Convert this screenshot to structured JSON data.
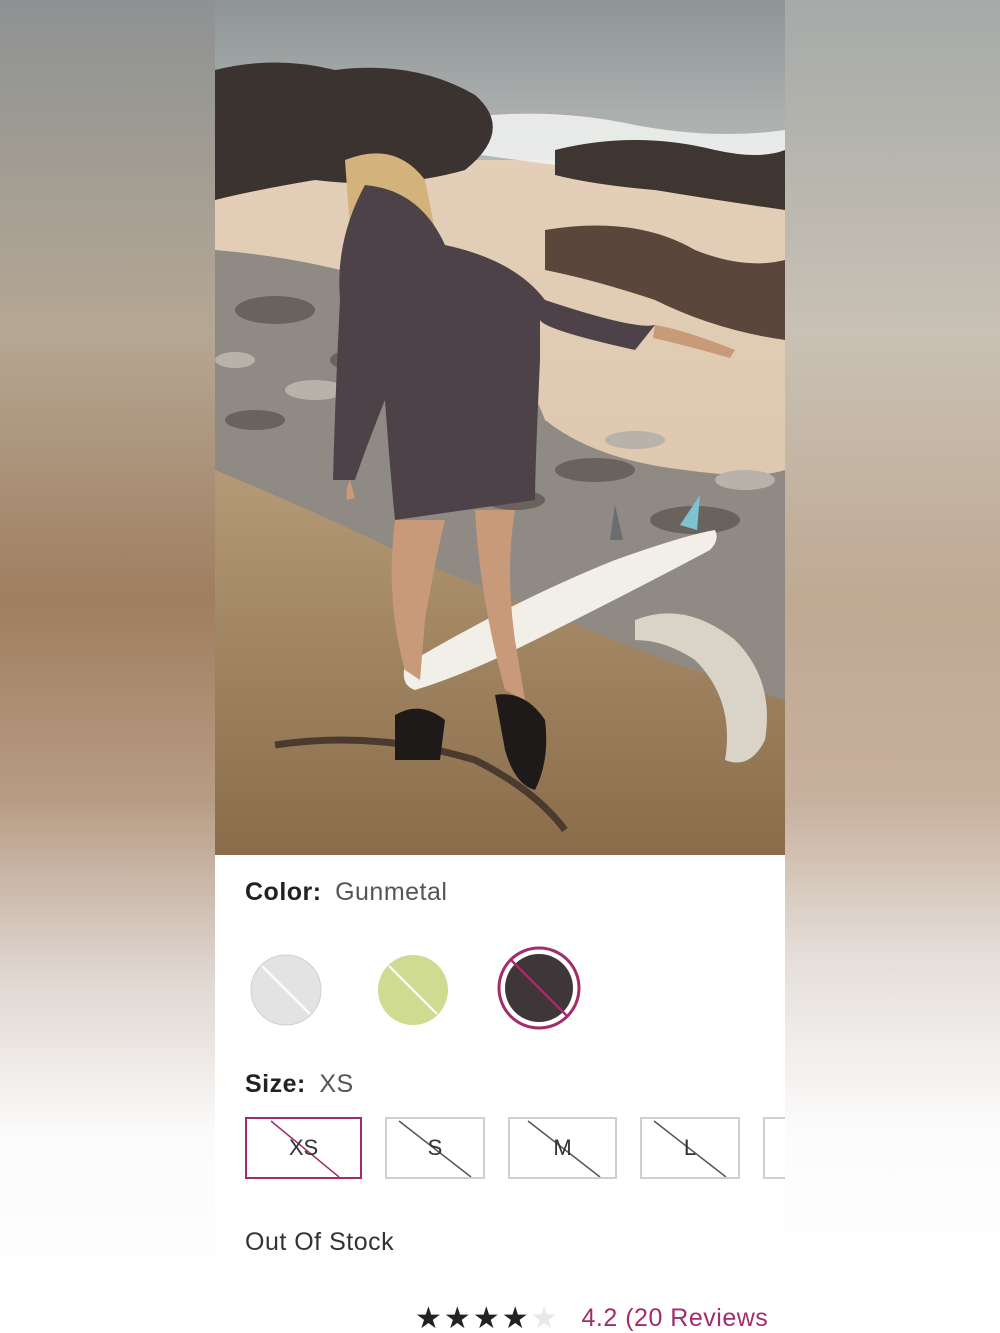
{
  "product": {
    "photo_alt": "Model walking on rocky beach toward surfboard wearing oversized dark t-shirt",
    "color": {
      "label": "Color:",
      "value": "Gunmetal"
    },
    "swatches": [
      {
        "name": "light grey",
        "hex": "#e3e3e3",
        "available": false,
        "selected": false
      },
      {
        "name": "lime",
        "hex": "#cfdb90",
        "available": false,
        "selected": false
      },
      {
        "name": "Gunmetal",
        "hex": "#3f363a",
        "available": false,
        "selected": true
      }
    ],
    "size": {
      "label": "Size:",
      "value": "XS"
    },
    "sizes": [
      {
        "label": "XS",
        "available": false,
        "selected": true
      },
      {
        "label": "S",
        "available": false,
        "selected": false
      },
      {
        "label": "M",
        "available": false,
        "selected": false
      },
      {
        "label": "L",
        "available": false,
        "selected": false
      },
      {
        "label": "",
        "available": false,
        "selected": false
      }
    ],
    "stock_status": "Out Of Stock",
    "rating": {
      "stars": 4.2,
      "text": "4.2 (20 Reviews"
    },
    "accent_color": "#a32d6c"
  }
}
